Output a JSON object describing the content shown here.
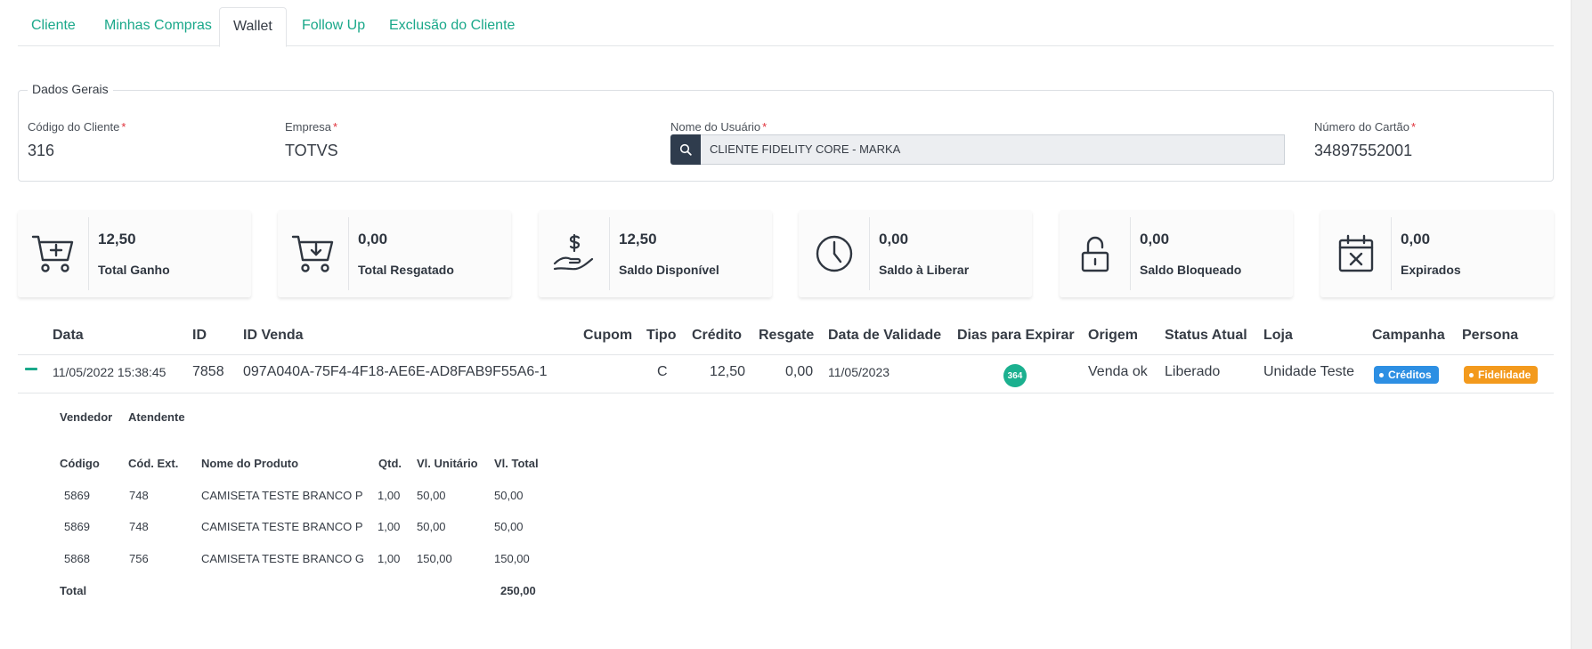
{
  "tabs": [
    "Cliente",
    "Minhas Compras",
    "Wallet",
    "Follow Up",
    "Exclusão do Cliente"
  ],
  "active_tab": "Wallet",
  "dados_gerais": {
    "legend": "Dados Gerais",
    "codigo_label": "Código do Cliente",
    "codigo_value": "316",
    "empresa_label": "Empresa",
    "empresa_value": "TOTVS",
    "usuario_label": "Nome do Usuário",
    "usuario_value": "CLIENTE FIDELITY CORE - MARKA",
    "cartao_label": "Número do Cartão",
    "cartao_value": "34897552001",
    "required_mark": "*"
  },
  "cards": [
    {
      "amount": "12,50",
      "label": "Total Ganho",
      "icon": "cart-plus-icon"
    },
    {
      "amount": "0,00",
      "label": "Total Resgatado",
      "icon": "cart-download-icon"
    },
    {
      "amount": "12,50",
      "label": "Saldo Disponível",
      "icon": "hand-dollar-icon"
    },
    {
      "amount": "0,00",
      "label": "Saldo à Liberar",
      "icon": "clock-icon"
    },
    {
      "amount": "0,00",
      "label": "Saldo Bloqueado",
      "icon": "padlock-open-icon"
    },
    {
      "amount": "0,00",
      "label": "Expirados",
      "icon": "calendar-x-icon"
    }
  ],
  "table": {
    "headers": [
      "Data",
      "ID",
      "ID Venda",
      "Cupom",
      "Tipo",
      "Crédito",
      "Resgate",
      "Data de Validade",
      "Dias para Expirar",
      "Origem",
      "Status Atual",
      "Loja",
      "Campanha",
      "Persona"
    ],
    "row": {
      "data": "11/05/2022 15:38:45",
      "id": "7858",
      "id_venda": "097A040A-75F4-4F18-AE6E-AD8FAB9F55A6-1",
      "cupom": "",
      "tipo": "C",
      "credito": "12,50",
      "resgate": "0,00",
      "data_validade": "11/05/2023",
      "dias_expirar": "364",
      "origem": "Venda ok",
      "status": "Liberado",
      "loja": "Unidade Teste",
      "campanha": "Créditos",
      "persona": "Fidelidade"
    }
  },
  "detail": {
    "vendedor_label": "Vendedor",
    "atendente_label": "Atendente",
    "headers": [
      "Código",
      "Cód. Ext.",
      "Nome do Produto",
      "Qtd.",
      "Vl. Unitário",
      "Vl. Total"
    ],
    "items": [
      [
        "5869",
        "748",
        "CAMISETA TESTE BRANCO P",
        "1,00",
        "50,00",
        "50,00"
      ],
      [
        "5869",
        "748",
        "CAMISETA TESTE BRANCO P",
        "1,00",
        "50,00",
        "50,00"
      ],
      [
        "5868",
        "756",
        "CAMISETA TESTE BRANCO G",
        "1,00",
        "150,00",
        "150,00"
      ]
    ],
    "total_label": "Total",
    "total_value": "250,00"
  },
  "colors": {
    "accent": "#1aa88a",
    "dark_button": "#2f3c4d",
    "badge_blue": "#2d8fe3",
    "badge_orange": "#f39a1d"
  }
}
